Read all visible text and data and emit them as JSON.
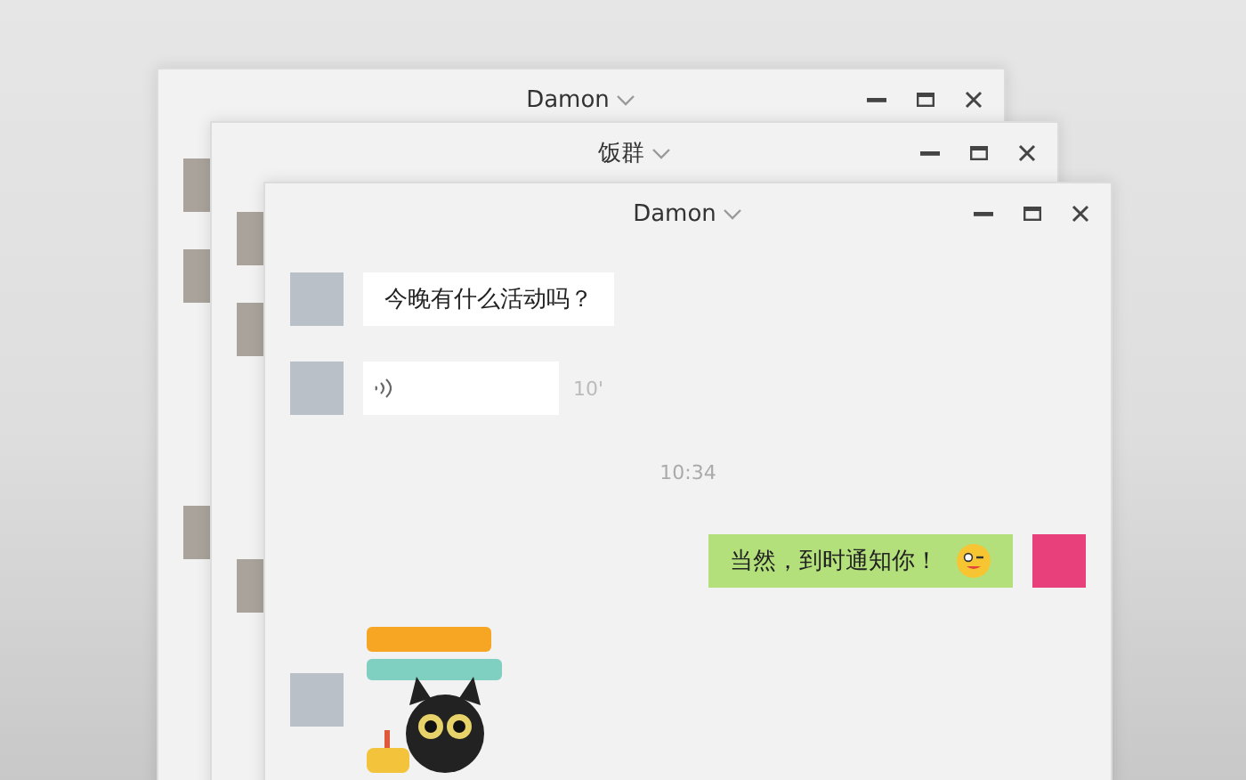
{
  "windows": [
    {
      "title": "Damon"
    },
    {
      "title": "饭群"
    },
    {
      "title": "Damon",
      "messages": [
        {
          "kind": "text",
          "own": false,
          "text": "今晚有什么活动吗？",
          "emoji": false
        },
        {
          "kind": "voice",
          "own": false,
          "duration": "10'"
        },
        {
          "kind": "time",
          "text": "10:34"
        },
        {
          "kind": "text",
          "own": true,
          "text": "当然，到时通知你！",
          "emoji": true
        },
        {
          "kind": "sticker",
          "own": false
        }
      ]
    }
  ]
}
